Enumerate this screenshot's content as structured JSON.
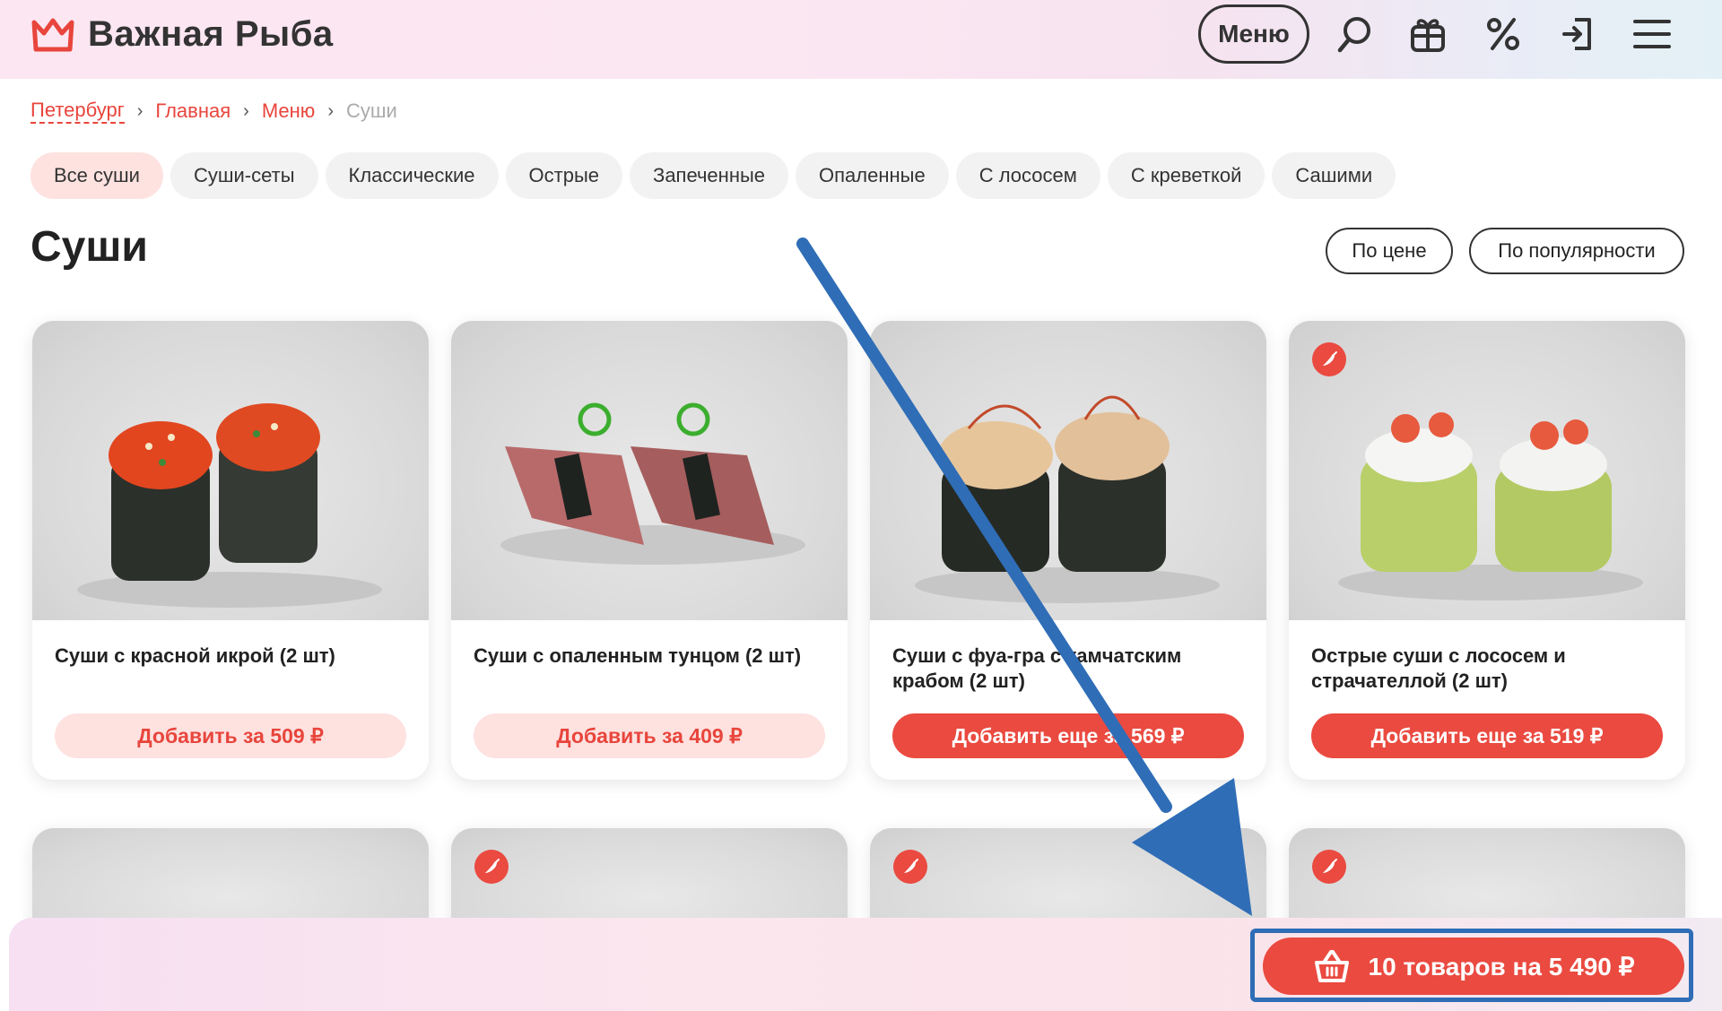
{
  "brand": {
    "name": "Важная Рыба",
    "accent": "#e8453c",
    "cart_accent": "#ea4a40",
    "annotation": "#2f6db6"
  },
  "header": {
    "menu_label": "Меню",
    "icons": [
      "search-icon",
      "gift-icon",
      "percent-icon",
      "login-icon",
      "hamburger-icon"
    ]
  },
  "breadcrumbs": {
    "city": "Петербург",
    "home": "Главная",
    "menu": "Меню",
    "current": "Суши"
  },
  "filters": [
    "Все суши",
    "Суши-сеты",
    "Классические",
    "Острые",
    "Запеченные",
    "Опаленные",
    "С лососем",
    "С креветкой",
    "Сашими"
  ],
  "page": {
    "title": "Суши",
    "sort_by_price": "По цене",
    "sort_by_popularity": "По популярности"
  },
  "products": [
    {
      "name": "Суши с красной икрой (2 шт)",
      "button": "Добавить за 509 ₽",
      "in_cart": false,
      "spicy": false
    },
    {
      "name": "Суши с опаленным тунцом (2 шт)",
      "button": "Добавить за 409 ₽",
      "in_cart": false,
      "spicy": false
    },
    {
      "name": "Суши с фуа-гра с камчатским крабом (2 шт)",
      "button": "Добавить еще за 569 ₽",
      "in_cart": true,
      "spicy": false
    },
    {
      "name": "Острые суши с лососем и страчателлой (2 шт)",
      "button": "Добавить еще за 519 ₽",
      "in_cart": true,
      "spicy": true
    }
  ],
  "second_row_spicy": [
    false,
    true,
    true,
    true
  ],
  "cart": {
    "label": "10 товаров на 5 490 ₽"
  }
}
